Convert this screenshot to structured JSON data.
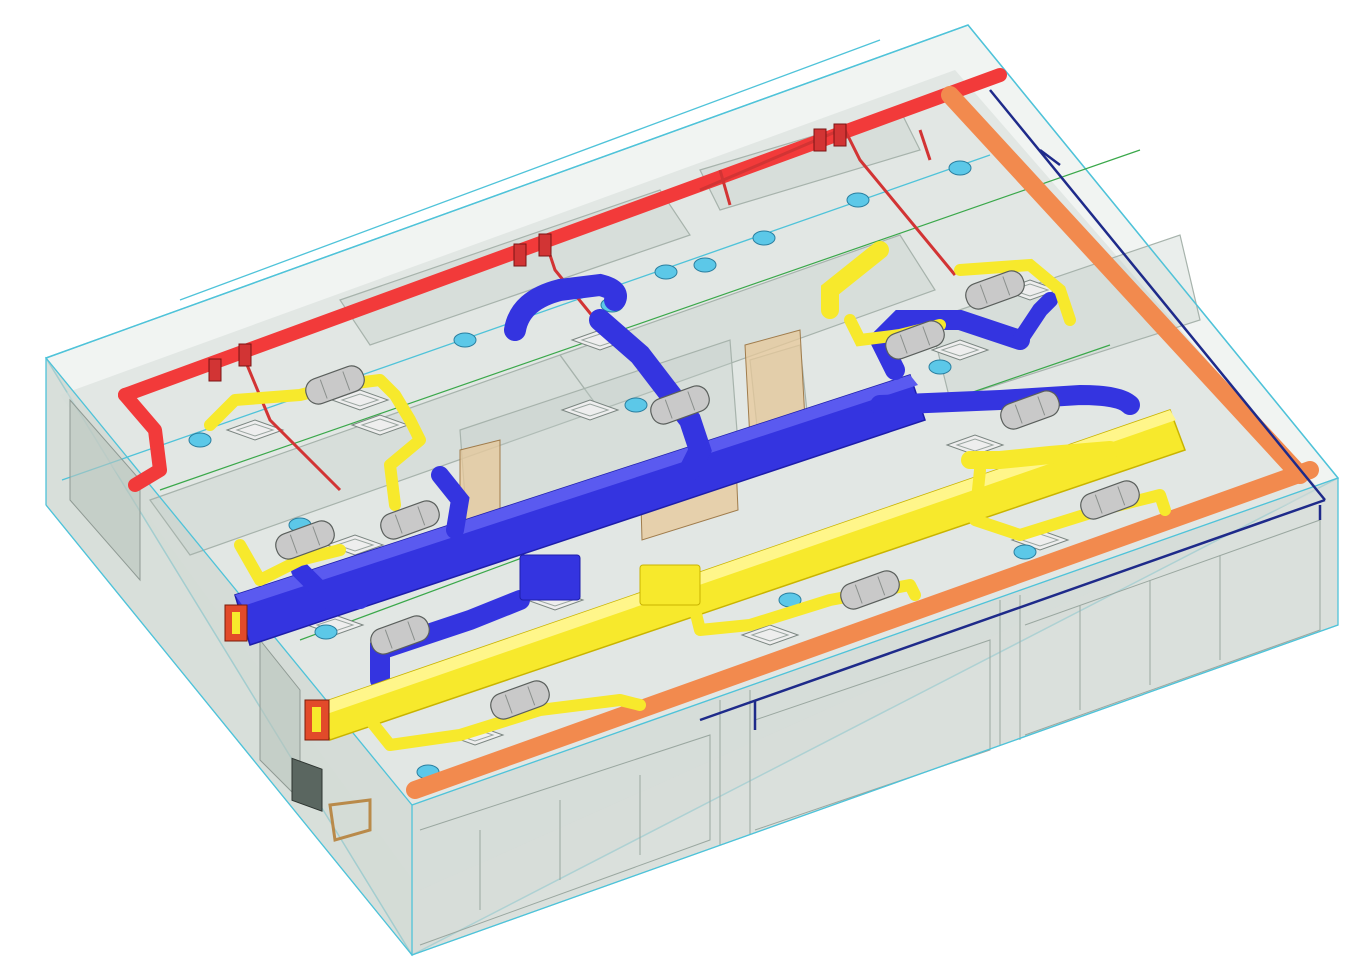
{
  "scene": {
    "kind": "isometric-mep-model",
    "colors": {
      "background": "#ffffff",
      "building_wall": "#cfd9d2",
      "building_edge": "#4fc3d9",
      "floor": "#d9e0dc",
      "partition": "#bfc9c3",
      "fire_pipe": "#f23a3a",
      "fire_branch": "#d23434",
      "supply_duct": "#f7e92c",
      "supply_edge": "#c9b400",
      "return_duct": "#3434e0",
      "return_edge": "#1e1eaa",
      "hot_water_pipe": "#f28a4e",
      "hot_water_edge": "#c0602e",
      "cold_water_pipe": "#1e2a8a",
      "fan_coil": "#c9c9c9",
      "diffuser": "#eeeeee",
      "sprinkler": "#5cc8e8",
      "green_line": "#3aa84a",
      "panel_tan": "#e7c89a"
    },
    "icons": [
      "fan-coil-unit-icon",
      "ceiling-diffuser-icon",
      "sprinkler-head-icon",
      "wall-louver-icon",
      "valve-icon"
    ]
  }
}
